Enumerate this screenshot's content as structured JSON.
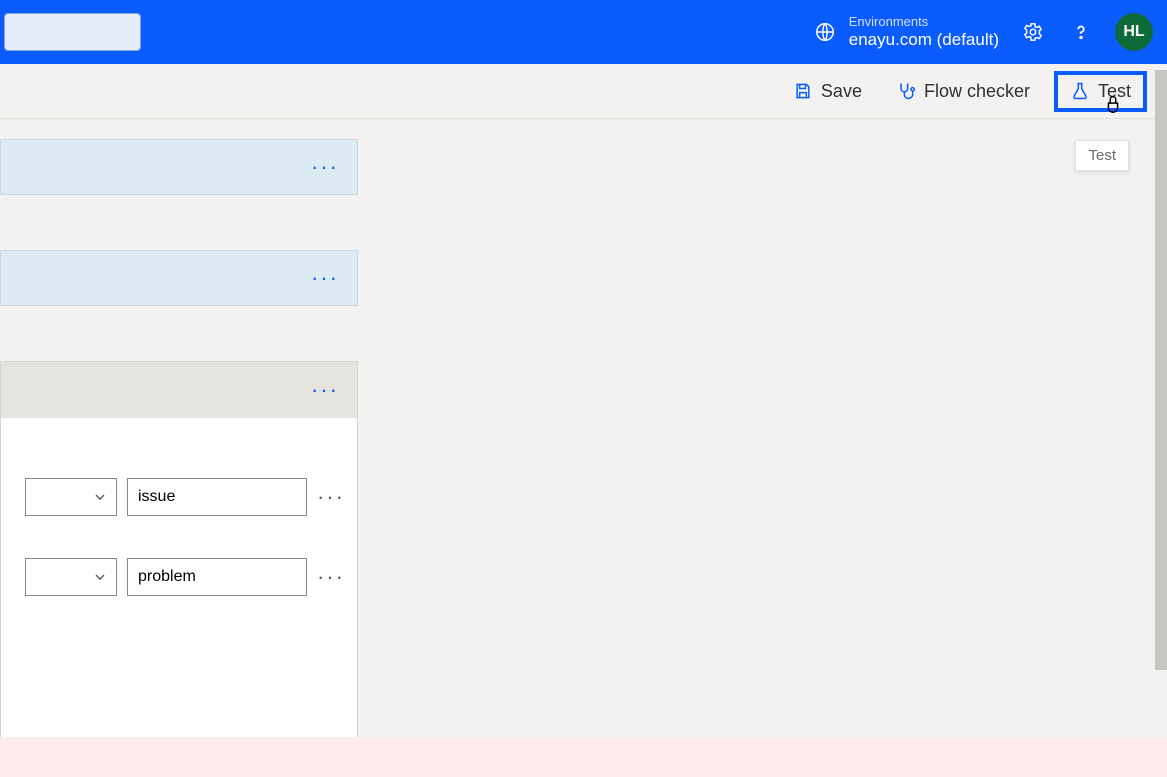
{
  "header": {
    "search_placeholder": "",
    "env_label": "Environments",
    "env_name": "enayu.com (default)",
    "avatar_initials": "HL"
  },
  "commands": {
    "save": "Save",
    "flow_checker": "Flow checker",
    "test": "Test",
    "tooltip_test": "Test"
  },
  "flow": {
    "card1_more": "···",
    "card2_more": "···",
    "condition_more": "···",
    "rows": [
      {
        "value": "issue",
        "more": "···"
      },
      {
        "value": "problem",
        "more": "···"
      }
    ]
  }
}
